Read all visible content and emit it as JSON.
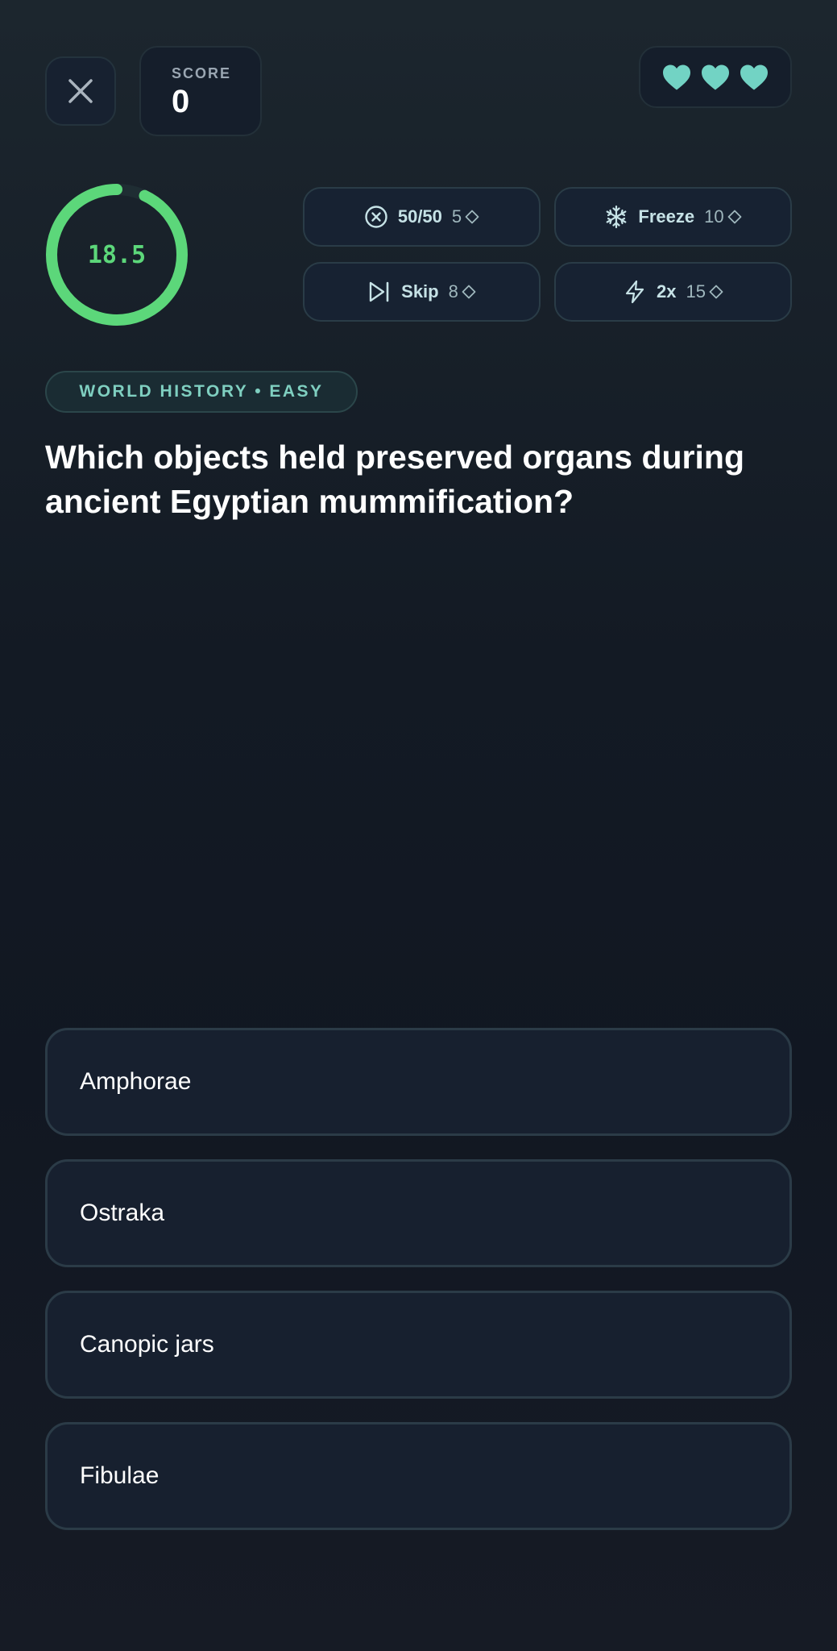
{
  "header": {
    "close_icon": "close-icon",
    "score_label": "SCORE",
    "score_value": "0",
    "lives": 3,
    "life_icon": "heart-icon"
  },
  "timer": {
    "value": "18.5",
    "progress": 0.93,
    "color": "#5cd77a"
  },
  "powerups": [
    {
      "label": "50/50",
      "cost": "5",
      "icon": "fifty-fifty-icon"
    },
    {
      "label": "Freeze",
      "cost": "10",
      "icon": "snowflake-icon"
    },
    {
      "label": "Skip",
      "cost": "8",
      "icon": "skip-icon"
    },
    {
      "label": "2x",
      "cost": "15",
      "icon": "lightning-icon"
    }
  ],
  "category": "WORLD HISTORY • EASY",
  "question": "Which objects held preserved organs during ancient Egyptian mummification?",
  "answers": [
    "Amphorae",
    "Ostraka",
    "Canopic jars",
    "Fibulae"
  ],
  "colors": {
    "accent": "#7fd6c8",
    "timer_green": "#5cd77a",
    "background": "#131a24"
  }
}
